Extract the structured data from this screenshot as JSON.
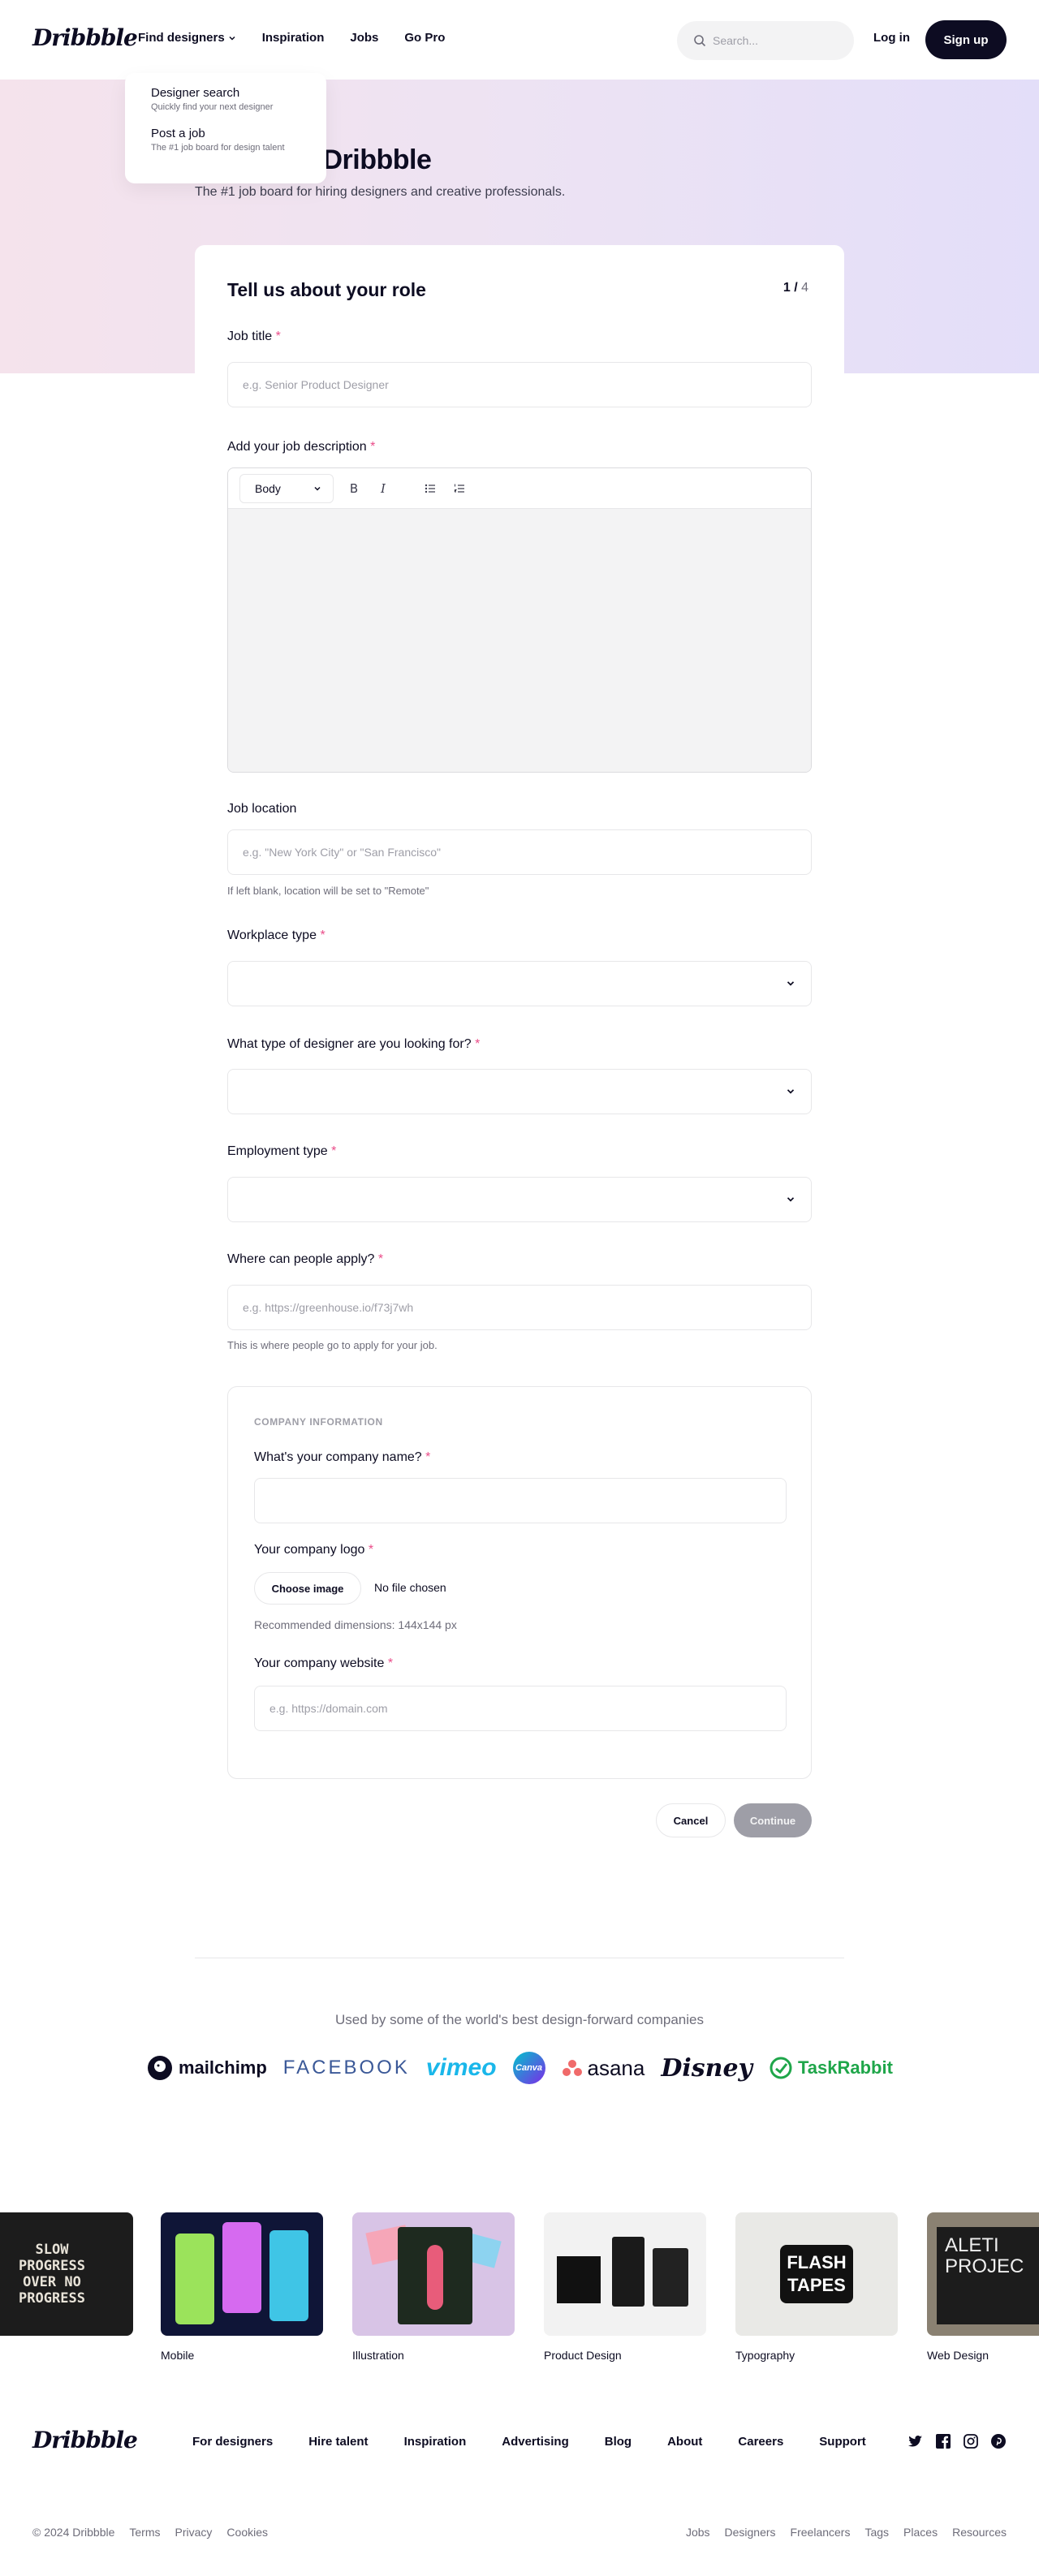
{
  "nav": {
    "logo": "Dribbble",
    "find_designers": "Find designers",
    "inspiration": "Inspiration",
    "jobs": "Jobs",
    "go_pro": "Go Pro",
    "search_placeholder": "Search...",
    "login": "Log in",
    "signup": "Sign up"
  },
  "dropdown": {
    "items": [
      {
        "title": "Designer search",
        "sub": "Quickly find your next designer"
      },
      {
        "title": "Post a job",
        "sub": "The #1 job board for design talent"
      }
    ]
  },
  "hero": {
    "title": "on Dribbble",
    "subtitle": "The #1 job board for hiring designers and creative professionals."
  },
  "form": {
    "title": "Tell us about your role",
    "step_current": "1 /",
    "step_total": " 4",
    "required_mark": "*",
    "job_title_label": "Job title",
    "job_title_placeholder": "e.g. Senior Product Designer",
    "description_label": "Add your job description",
    "editor_format": "Body",
    "editor_bold": "B",
    "editor_italic": "I",
    "location_label": "Job location",
    "location_placeholder": "e.g. \"New York City\" or \"San Francisco\"",
    "location_help": "If left blank, location will be set to \"Remote\"",
    "workplace_label": "Workplace type",
    "designer_type_label": "What type of designer are you looking for?",
    "employment_label": "Employment type",
    "apply_label": "Where can people apply?",
    "apply_placeholder": "e.g. https://greenhouse.io/f73j7wh",
    "apply_help": "This is where people go to apply for your job.",
    "company": {
      "heading": "COMPANY INFORMATION",
      "name_label": "What's your company name?",
      "logo_label": "Your company logo",
      "choose_image": "Choose image",
      "no_file": "No file chosen",
      "logo_help": "Recommended dimensions: 144x144 px",
      "website_label": "Your company website",
      "website_placeholder": "e.g. https://domain.com"
    },
    "cancel": "Cancel",
    "continue": "Continue"
  },
  "companies": {
    "heading": "Used by some of the world's best design-forward companies",
    "logos": [
      "mailchimp",
      "FACEBOOK",
      "vimeo",
      "Canva",
      "asana",
      "Disney",
      "TaskRabbit"
    ]
  },
  "shots": [
    {
      "label": ""
    },
    {
      "label": "Mobile"
    },
    {
      "label": "Illustration"
    },
    {
      "label": "Product Design"
    },
    {
      "label": "Typography"
    },
    {
      "label": "Web Design"
    }
  ],
  "shot_text": {
    "slow": "SLOW PROGRESS OVER NO PROGRESS",
    "flash": "FLASH TAPES",
    "aleti": "ALETI PROJEC"
  },
  "footer": {
    "logo": "Dribbble",
    "links": [
      "For designers",
      "Hire talent",
      "Inspiration",
      "Advertising",
      "Blog",
      "About",
      "Careers",
      "Support"
    ],
    "copyright": "© 2024 Dribbble",
    "legal": [
      "Terms",
      "Privacy",
      "Cookies"
    ],
    "right_links": [
      "Jobs",
      "Designers",
      "Freelancers",
      "Tags",
      "Places",
      "Resources"
    ]
  },
  "colors": {
    "ink": "#0d0c22",
    "accent_pink": "#ea4c89",
    "muted": "#6e6d7a",
    "disabled_button": "#9e9ea7"
  }
}
